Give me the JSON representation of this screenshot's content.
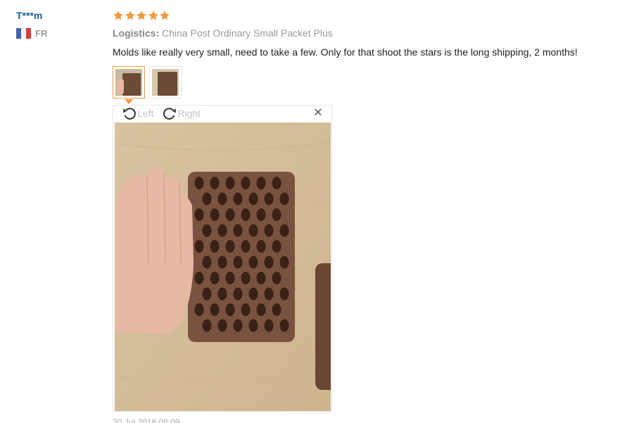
{
  "reviewer": {
    "name": "T***m",
    "country_code": "FR",
    "flag_icon": "france-flag-icon"
  },
  "review": {
    "rating": 5,
    "rating_max": 5,
    "star_color": "#f19a3d",
    "logistics_label": "Logistics:",
    "logistics_value": "China Post Ordinary Small Packet Plus",
    "text": "Molds like really very small, need to take a few. Only for that shoot the stars is the long shipping, 2 months!",
    "thumbnails": [
      {
        "name": "review-photo-1",
        "active": true
      },
      {
        "name": "review-photo-2",
        "active": false
      }
    ]
  },
  "viewer": {
    "rotate_left_label": "Left",
    "rotate_right_label": "Right",
    "close_icon": "close-icon",
    "accent": "#f19a3d"
  },
  "footer": {
    "date": "30 Jul 2018 08:09"
  }
}
